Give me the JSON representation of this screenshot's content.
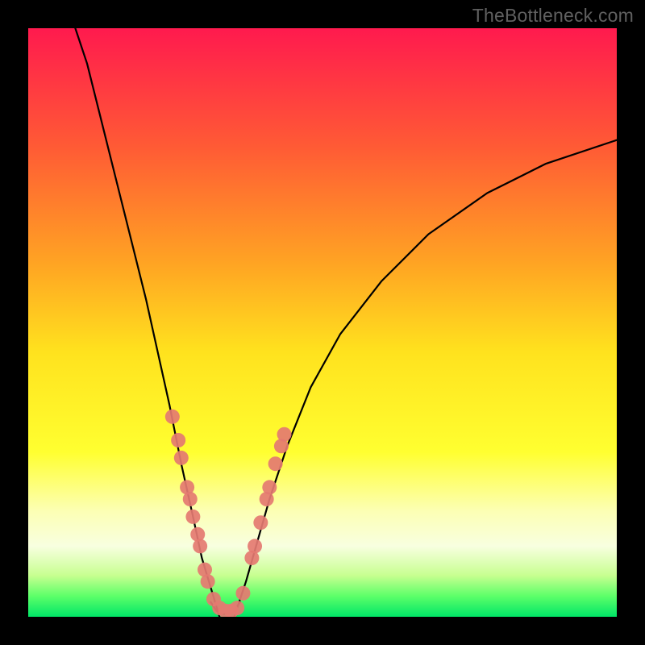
{
  "watermark": "TheBottleneck.com",
  "chart_data": {
    "type": "line",
    "title": "",
    "xlabel": "",
    "ylabel": "",
    "xlim": [
      0,
      100
    ],
    "ylim": [
      0,
      100
    ],
    "grid": false,
    "legend": false,
    "background_gradient_stops": [
      {
        "offset": 0,
        "color": "#ff1a4e"
      },
      {
        "offset": 0.2,
        "color": "#ff5a35"
      },
      {
        "offset": 0.4,
        "color": "#ffa423"
      },
      {
        "offset": 0.55,
        "color": "#ffe21e"
      },
      {
        "offset": 0.72,
        "color": "#ffff30"
      },
      {
        "offset": 0.82,
        "color": "#fcffb4"
      },
      {
        "offset": 0.88,
        "color": "#f8ffe0"
      },
      {
        "offset": 0.93,
        "color": "#c7ff90"
      },
      {
        "offset": 0.965,
        "color": "#5cff69"
      },
      {
        "offset": 1.0,
        "color": "#00e667"
      }
    ],
    "series": [
      {
        "name": "left-branch",
        "x": [
          8,
          10,
          12,
          14,
          16,
          18,
          20,
          22,
          24,
          26,
          28,
          29.5,
          31,
          32.5
        ],
        "y": [
          100,
          94,
          86,
          78,
          70,
          62,
          54,
          45,
          36,
          26,
          17,
          10,
          5,
          0
        ]
      },
      {
        "name": "right-branch",
        "x": [
          35,
          37,
          39,
          41,
          44,
          48,
          53,
          60,
          68,
          78,
          88,
          100
        ],
        "y": [
          0,
          6,
          13,
          20,
          29,
          39,
          48,
          57,
          65,
          72,
          77,
          81
        ]
      },
      {
        "name": "valley-floor",
        "x": [
          31,
          32,
          33,
          34,
          35,
          36
        ],
        "y": [
          2.5,
          1.0,
          0.5,
          0.5,
          1.0,
          2.5
        ]
      }
    ],
    "markers": [
      {
        "x": 24.5,
        "y": 34
      },
      {
        "x": 25.5,
        "y": 30
      },
      {
        "x": 26.0,
        "y": 27
      },
      {
        "x": 27.0,
        "y": 22
      },
      {
        "x": 27.5,
        "y": 20
      },
      {
        "x": 28.0,
        "y": 17
      },
      {
        "x": 28.8,
        "y": 14
      },
      {
        "x": 29.2,
        "y": 12
      },
      {
        "x": 30.0,
        "y": 8
      },
      {
        "x": 30.5,
        "y": 6
      },
      {
        "x": 31.5,
        "y": 3
      },
      {
        "x": 32.5,
        "y": 1.5
      },
      {
        "x": 33.5,
        "y": 1.0
      },
      {
        "x": 34.5,
        "y": 1.0
      },
      {
        "x": 35.5,
        "y": 1.5
      },
      {
        "x": 36.5,
        "y": 4
      },
      {
        "x": 38.0,
        "y": 10
      },
      {
        "x": 38.5,
        "y": 12
      },
      {
        "x": 39.5,
        "y": 16
      },
      {
        "x": 40.5,
        "y": 20
      },
      {
        "x": 41.0,
        "y": 22
      },
      {
        "x": 42.0,
        "y": 26
      },
      {
        "x": 43.0,
        "y": 29
      },
      {
        "x": 43.5,
        "y": 31
      }
    ],
    "marker_color": "#e47a71",
    "curve_color": "#000000",
    "curve_width": 2.2
  }
}
